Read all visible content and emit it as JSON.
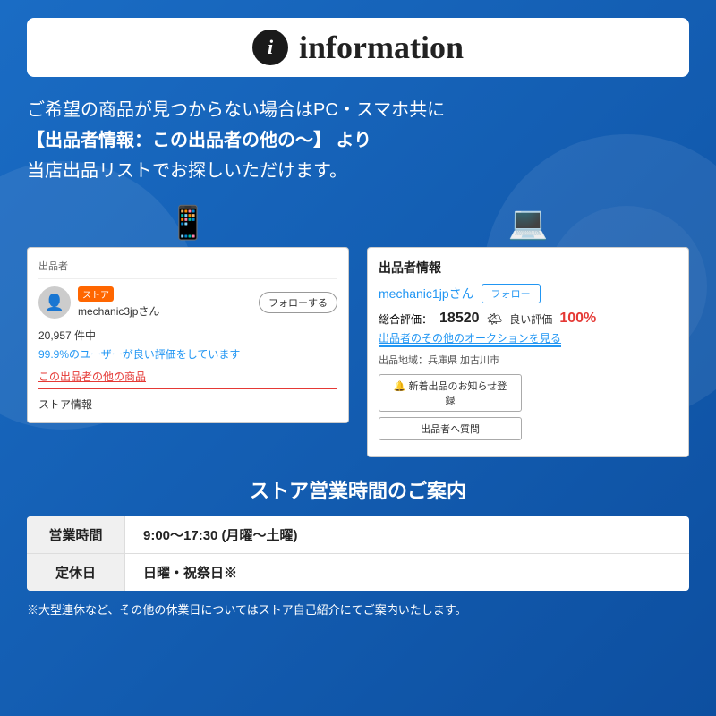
{
  "header": {
    "info_icon_label": "i",
    "title": "information"
  },
  "main_text": {
    "line1": "ご希望の商品が見つからない場合はPC・スマホ共に",
    "line2": "【出品者情報：この出品者の他の〜】 より",
    "line3": "当店出品リストでお探しいただけます。"
  },
  "left_screenshot": {
    "device_icon": "📱",
    "header_text": "出品者",
    "store_badge": "ストア",
    "seller_name": "mechanic3jpさん",
    "follow_label": "フォローする",
    "stats_text": "20,957 件中",
    "rating_text": "99.9%のユーザーが良い評価をしています",
    "link_text": "この出品者の他の商品",
    "store_info_label": "ストア情報"
  },
  "right_screenshot": {
    "device_icon": "💻",
    "section_title": "出品者情報",
    "seller_name": "mechanic1jpさん",
    "follow_label": "フォロー",
    "rating_label": "総合評価：",
    "rating_score": "18520",
    "good_label": "良い評価",
    "good_pct": "100%",
    "auction_link": "出品者のその他のオークションを見る",
    "location_label": "出品地域：兵庫県 加古川市",
    "notify_btn": "🔔 新着出品のお知らせ登録",
    "question_btn": "出品者へ質問"
  },
  "business_hours": {
    "heading": "ストア営業時間のご案内",
    "rows": [
      {
        "label": "営業時間",
        "value": "9:00〜17:30 (月曜〜土曜)"
      },
      {
        "label": "定休日",
        "value": "日曜・祝祭日※"
      }
    ],
    "footnote": "※大型連休など、その他の休業日についてはストア自己紹介にてご案内いたします。"
  }
}
